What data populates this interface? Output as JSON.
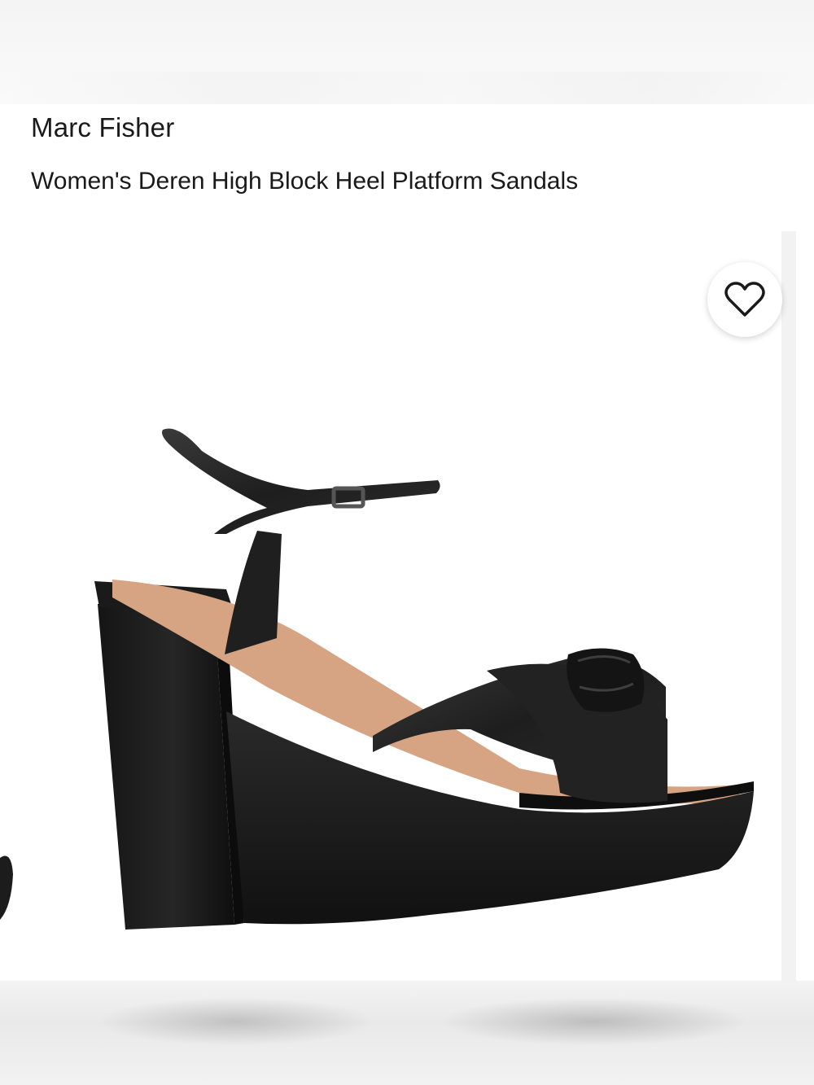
{
  "product": {
    "brand": "Marc Fisher",
    "name": "Women's Deren High Block Heel Platform Sandals"
  },
  "gallery": {
    "image_alt": "Black platform sandal with knotted toe strap and ankle buckle",
    "wishlist_icon": "heart-outline-icon"
  },
  "colors": {
    "text": "#1a1a1a",
    "shoe": "#1c1c1c",
    "insole": "#d9a98a"
  }
}
